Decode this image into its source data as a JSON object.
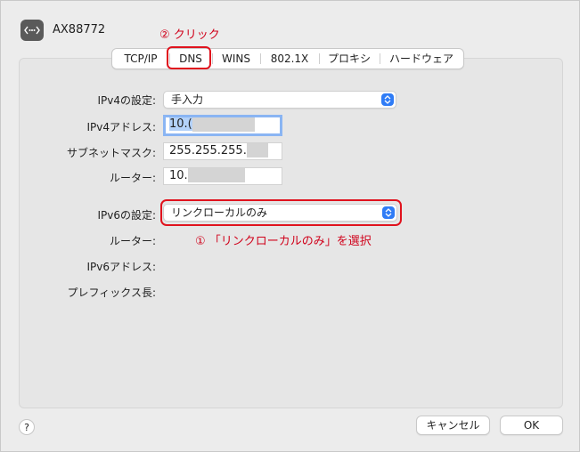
{
  "header": {
    "title": "AX88772",
    "icon": "network-dots-icon"
  },
  "annotations": {
    "click": "② クリック",
    "select": "① 「リンクローカルのみ」を選択"
  },
  "tabs": [
    {
      "label": "TCP/IP"
    },
    {
      "label": "DNS"
    },
    {
      "label": "WINS"
    },
    {
      "label": "802.1X"
    },
    {
      "label": "プロキシ"
    },
    {
      "label": "ハードウェア"
    }
  ],
  "ipv4": {
    "config_label": "IPv4の設定:",
    "config_value": "手入力",
    "address_label": "IPv4アドレス:",
    "address_value": "10.(",
    "subnet_label": "サブネットマスク:",
    "subnet_value": "255.255.255.",
    "router_label": "ルーター:",
    "router_value": "10."
  },
  "ipv6": {
    "config_label": "IPv6の設定:",
    "config_value": "リンクローカルのみ",
    "router_label": "ルーター:",
    "address_label": "IPv6アドレス:",
    "prefix_label": "プレフィックス長:"
  },
  "footer": {
    "help": "?",
    "cancel": "キャンセル",
    "ok": "OK"
  },
  "colors": {
    "accent": "#2f7cf6",
    "annotation": "#e0121d"
  }
}
